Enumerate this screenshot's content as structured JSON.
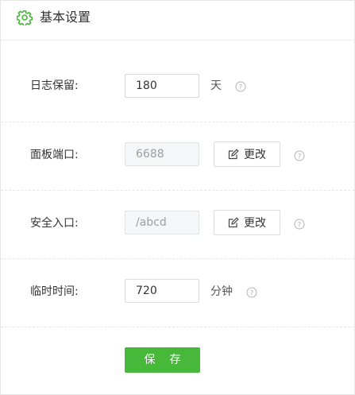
{
  "header": {
    "title": "基本设置",
    "icon": "gear-icon",
    "accent": "#47b83a"
  },
  "settings": {
    "log_retention": {
      "label": "日志保留:",
      "value": "180",
      "unit": "天"
    },
    "panel_port": {
      "label": "面板端口:",
      "value": "6688",
      "button": "更改"
    },
    "security_entry": {
      "label": "安全入口:",
      "value": "/abcd",
      "button": "更改"
    },
    "temp_time": {
      "label": "临时时间:",
      "value": "720",
      "unit": "分钟"
    }
  },
  "actions": {
    "save_label": "保存",
    "save_color": "#47b83a"
  }
}
